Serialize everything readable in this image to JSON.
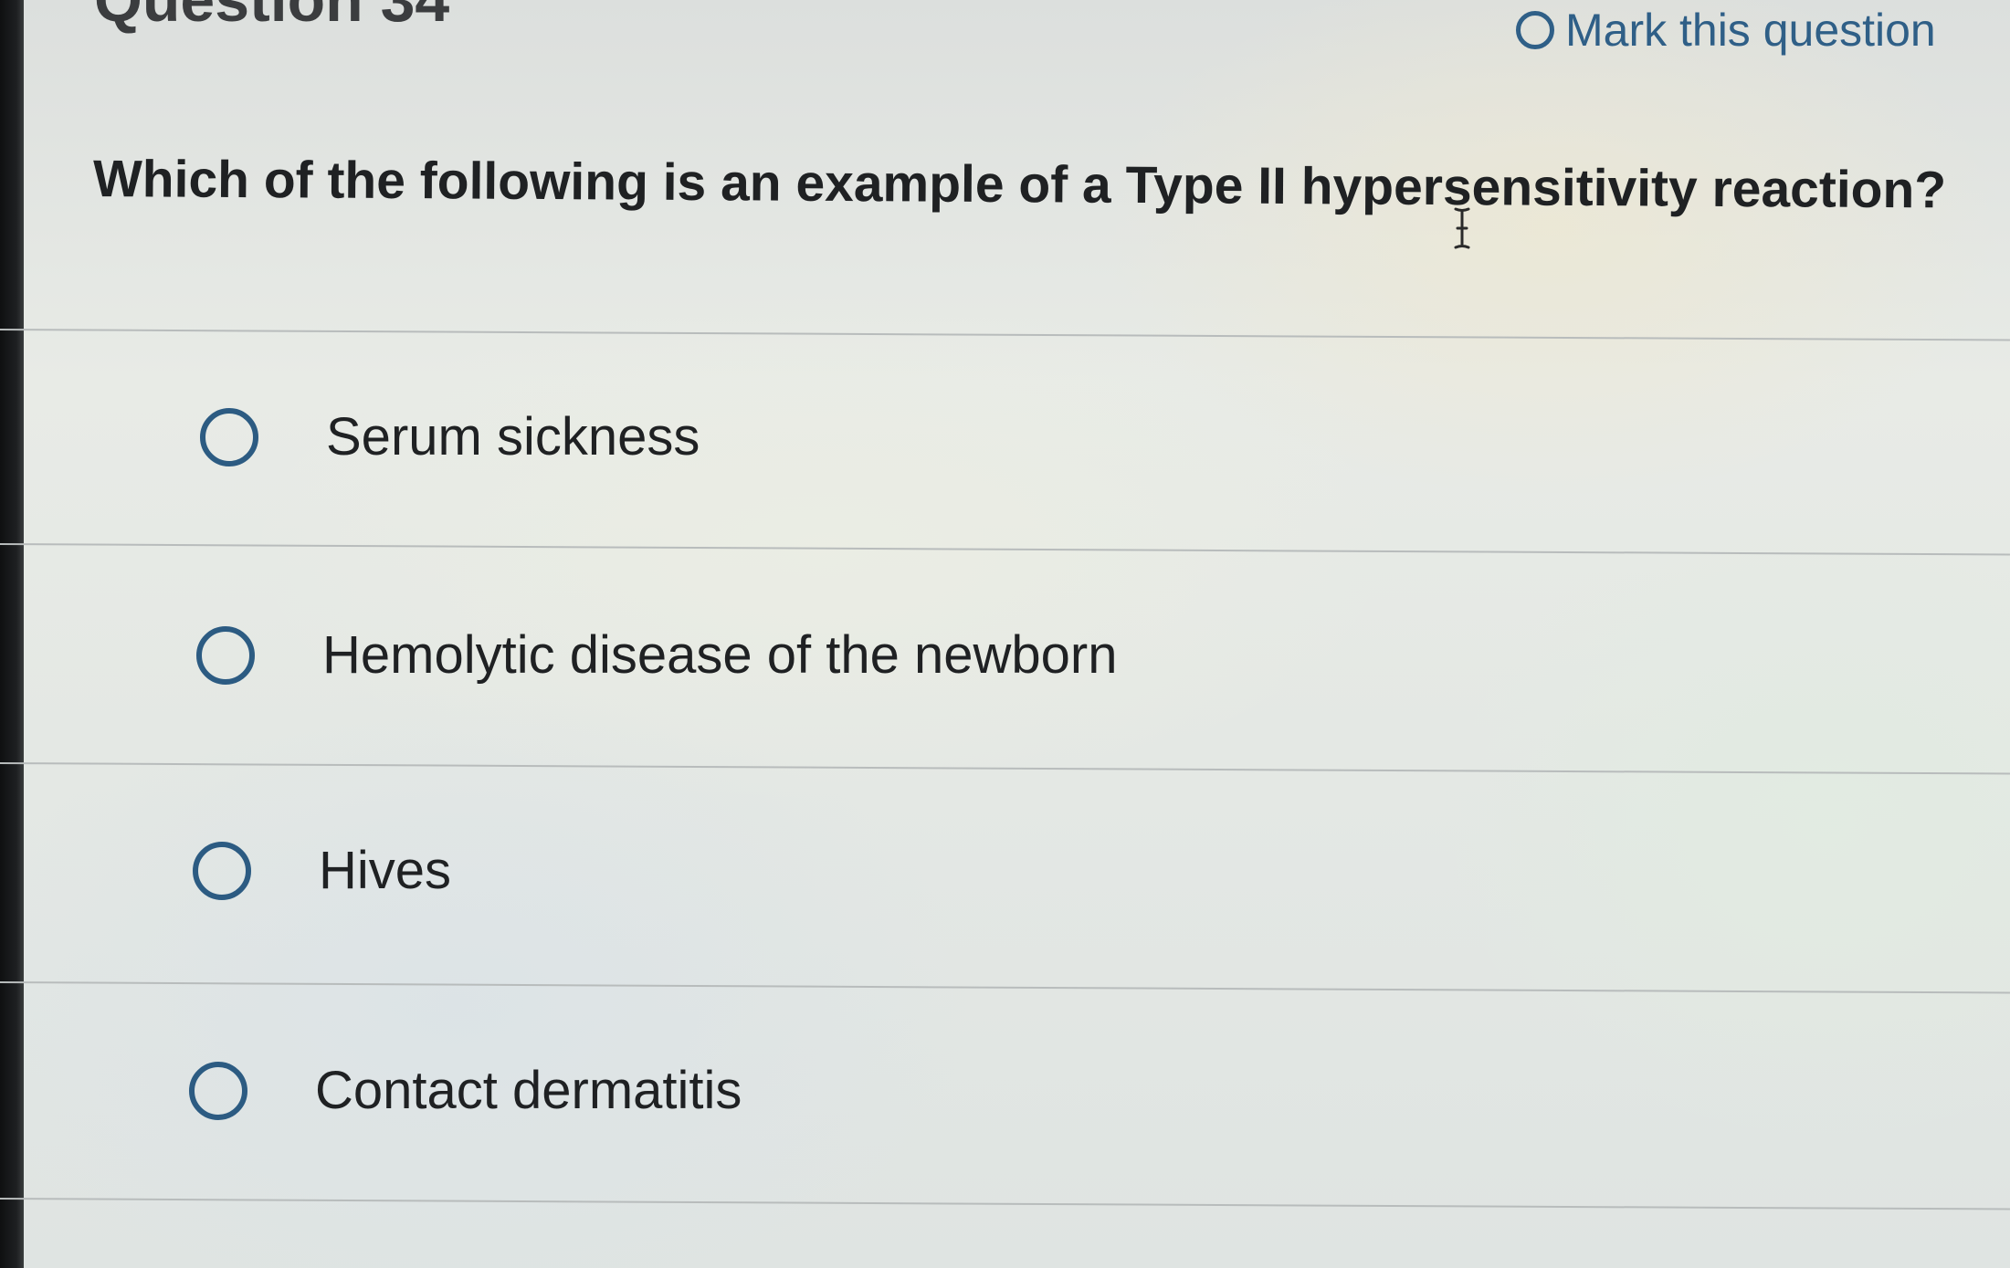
{
  "header": {
    "question_number": "Question 34",
    "mark_label": "Mark this question"
  },
  "question": {
    "text": "Which of the following is an example of a Type II hypersensitivity reaction?"
  },
  "options": [
    {
      "label": "Serum sickness"
    },
    {
      "label": "Hemolytic disease of the newborn"
    },
    {
      "label": "Hives"
    },
    {
      "label": "Contact dermatitis"
    }
  ],
  "colors": {
    "accent": "#2c5b82",
    "text": "#1f2123",
    "divider": "#b8bcbc"
  },
  "icons": {
    "mark": "circle-outline-icon",
    "option_radio": "radio-unselected-icon",
    "cursor": "text-cursor-icon"
  }
}
